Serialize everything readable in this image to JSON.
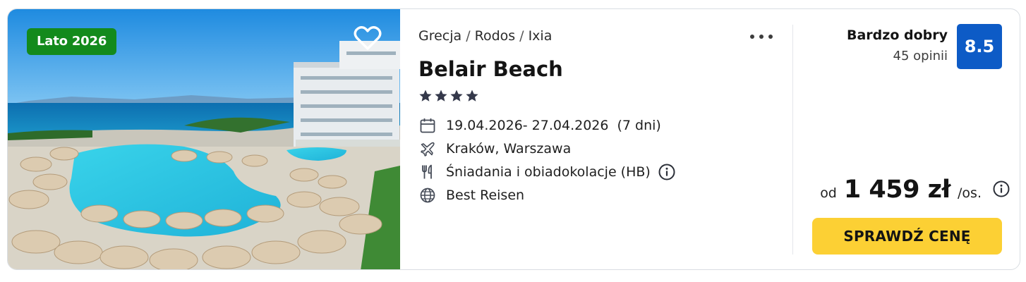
{
  "offer": {
    "season_badge": "Lato 2026",
    "breadcrumb": [
      "Grecja",
      "Rodos",
      "Ixia"
    ],
    "hotel_name": "Belair Beach",
    "stars": 4,
    "dates": "19.04.2026- 27.04.2026",
    "duration": "(7 dni)",
    "departure": "Kraków, Warszawa",
    "board": "Śniadania i obiadokolacje (HB)",
    "operator": "Best Reisen",
    "rating": {
      "label": "Bardzo dobry",
      "reviews": "45 opinii",
      "score": "8.5"
    },
    "price": {
      "prefix": "od",
      "value": "1 459 zł",
      "unit": "/os."
    },
    "cta_label": "SPRAWDŹ CENĘ"
  },
  "icons": {
    "favorite": "heart-outline-icon",
    "more": "more-dots-icon",
    "star": "star-icon",
    "calendar": "calendar-icon",
    "flight": "plane-icon",
    "board": "cutlery-icon",
    "operator": "globe-icon",
    "info": "info-icon"
  },
  "colors": {
    "season_badge": "#138a1c",
    "score_badge": "#0d5bc6",
    "cta": "#fcd034"
  }
}
